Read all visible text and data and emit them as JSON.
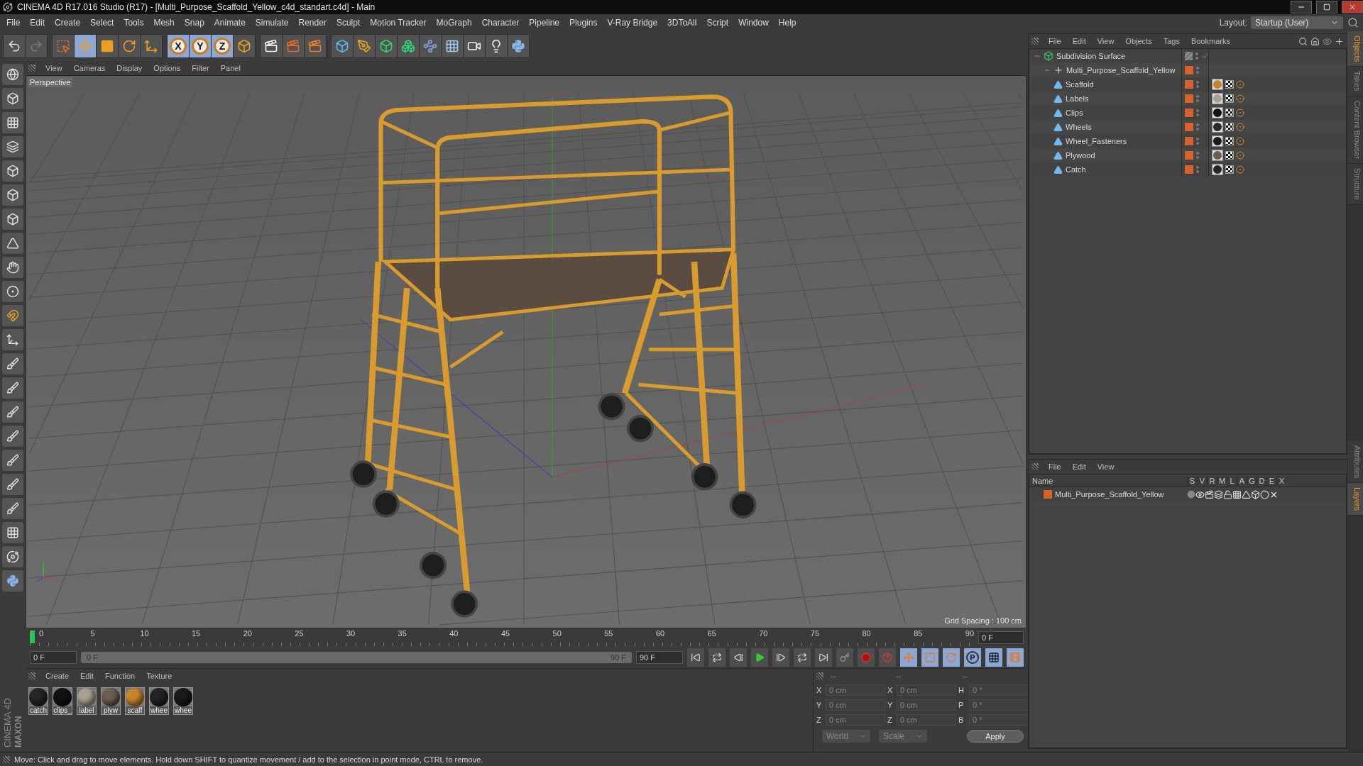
{
  "window": {
    "title": "CINEMA 4D R17.016 Studio (R17) - [Multi_Purpose_Scaffold_Yellow_c4d_standart.c4d] - Main"
  },
  "menu": [
    "File",
    "Edit",
    "Create",
    "Select",
    "Tools",
    "Mesh",
    "Snap",
    "Animate",
    "Simulate",
    "Render",
    "Sculpt",
    "Motion Tracker",
    "MoGraph",
    "Character",
    "Pipeline",
    "Plugins",
    "V-Ray Bridge",
    "3DToAll",
    "Script",
    "Window",
    "Help"
  ],
  "layout": {
    "label": "Layout:",
    "value": "Startup (User)"
  },
  "toolbar": [
    {
      "kind": "undo",
      "selected": false
    },
    {
      "kind": "redo",
      "selected": false
    },
    {
      "kind": "select",
      "selected": false
    },
    {
      "kind": "move",
      "selected": true
    },
    {
      "kind": "scale",
      "selected": false
    },
    {
      "kind": "rotate",
      "selected": false
    },
    {
      "kind": "move-add",
      "selected": false
    },
    {
      "kind": "axis",
      "glyph": "X",
      "selected": true
    },
    {
      "kind": "axis",
      "glyph": "Y",
      "selected": true
    },
    {
      "kind": "axis",
      "glyph": "Z",
      "selected": true
    },
    {
      "kind": "coords",
      "selected": false
    },
    {
      "kind": "render-view",
      "selected": false
    },
    {
      "kind": "render",
      "selected": false
    },
    {
      "kind": "render-settings",
      "selected": false
    },
    {
      "kind": "cube",
      "selected": false
    },
    {
      "kind": "pen",
      "selected": false
    },
    {
      "kind": "subdivision",
      "selected": false
    },
    {
      "kind": "cloner",
      "selected": false
    },
    {
      "kind": "deformer",
      "selected": false
    },
    {
      "kind": "floor",
      "selected": false
    },
    {
      "kind": "camera",
      "selected": false
    },
    {
      "kind": "light",
      "selected": false
    },
    {
      "kind": "python",
      "selected": false
    }
  ],
  "viewport": {
    "menu": [
      "View",
      "Cameras",
      "Display",
      "Options",
      "Filter",
      "Panel"
    ],
    "camera": "Perspective",
    "grid_spacing": "Grid Spacing : 100 cm"
  },
  "timeline": {
    "ticks": [
      "0",
      "5",
      "10",
      "15",
      "20",
      "25",
      "30",
      "35",
      "40",
      "45",
      "50",
      "55",
      "60",
      "65",
      "70",
      "75",
      "80",
      "85",
      "90"
    ],
    "current": "0 F",
    "start": "0 F",
    "range": {
      "start": "0 F",
      "end": "90 F",
      "level": 1
    },
    "end": "90 F"
  },
  "anim_tools": [
    {
      "kind": "move",
      "selected": true
    },
    {
      "kind": "scale",
      "selected": true
    },
    {
      "kind": "rotate",
      "selected": true
    },
    {
      "kind": "param",
      "glyph": "P",
      "selected": true
    },
    {
      "kind": "grid",
      "selected": true
    },
    {
      "kind": "film",
      "selected": true
    }
  ],
  "materials": {
    "menu": [
      "Create",
      "Edit",
      "Function",
      "Texture"
    ],
    "items": [
      {
        "name": "catch",
        "color": "#262626"
      },
      {
        "name": "clips_",
        "color": "#111111"
      },
      {
        "name": "label",
        "color": "#a8a090"
      },
      {
        "name": "plyw",
        "color": "#6e5e50"
      },
      {
        "name": "scaff",
        "color": "#c4862c"
      },
      {
        "name": "whee",
        "color": "#232323"
      },
      {
        "name": "whee",
        "color": "#1a1a1a"
      }
    ]
  },
  "coordinates": {
    "headers": [
      "--",
      "--",
      "--"
    ],
    "rows": [
      {
        "axis": "X",
        "position": "0 cm",
        "size_axis": "X",
        "size": "0 cm",
        "rot_axis": "H",
        "rotation": "0 °"
      },
      {
        "axis": "Y",
        "position": "0 cm",
        "size_axis": "Y",
        "size": "0 cm",
        "rot_axis": "P",
        "rotation": "0 °"
      },
      {
        "axis": "Z",
        "position": "0 cm",
        "size_axis": "Z",
        "size": "0 cm",
        "rot_axis": "B",
        "rotation": "0 °"
      }
    ],
    "space": "World",
    "mode": "Scale",
    "apply": "Apply"
  },
  "objects": {
    "menu": [
      "File",
      "Edit",
      "View",
      "Objects",
      "Tags",
      "Bookmarks"
    ],
    "tree": [
      {
        "name": "Subdivision Surface",
        "kind": "subdivision",
        "enabled": true,
        "children": [
          {
            "name": "Multi_Purpose_Scaffold_Yellow",
            "kind": "null",
            "color": "#d9622b",
            "children": [
              {
                "name": "Scaffold",
                "kind": "mesh",
                "color": "#d9622b",
                "tag": {
                  "color": "#c4862c"
                }
              },
              {
                "name": "Labels",
                "kind": "mesh",
                "color": "#d9622b",
                "tag": {
                  "color": "#a8a090"
                }
              },
              {
                "name": "Clips",
                "kind": "mesh",
                "color": "#d9622b",
                "tag": {
                  "color": "#111111"
                }
              },
              {
                "name": "Wheels",
                "kind": "mesh",
                "color": "#d9622b",
                "tag": {
                  "color": "#2a2a2a"
                }
              },
              {
                "name": "Wheel_Fasteners",
                "kind": "mesh",
                "color": "#d9622b",
                "tag": {
                  "color": "#1c1c1c"
                }
              },
              {
                "name": "Plywood",
                "kind": "mesh",
                "color": "#d9622b",
                "tag": {
                  "color": "#6e5e50"
                }
              },
              {
                "name": "Catch",
                "kind": "mesh",
                "color": "#d9622b",
                "tag": {
                  "color": "#262626"
                }
              }
            ]
          }
        ]
      }
    ]
  },
  "layers": {
    "menu": [
      "File",
      "Edit",
      "View"
    ],
    "columns": [
      "Name",
      "S",
      "V",
      "R",
      "M",
      "L",
      "A",
      "G",
      "D",
      "E",
      "X"
    ],
    "rows": [
      {
        "name": "Multi_Purpose_Scaffold_Yellow",
        "color": "#d9622b"
      }
    ]
  },
  "side_tabs_top": [
    {
      "label": "Objects",
      "selected": true
    },
    {
      "label": "Takes",
      "selected": false
    },
    {
      "label": "Content Browser",
      "selected": false
    },
    {
      "label": "Structure",
      "selected": false
    }
  ],
  "side_tabs_bottom": [
    {
      "label": "Attributes",
      "selected": false
    },
    {
      "label": "Layers",
      "selected": true
    }
  ],
  "brand": {
    "maker": "MAXON",
    "product": "CINEMA 4D"
  },
  "status_bar": "Move: Click and drag to move elements. Hold down SHIFT to quantize movement / add to the selection in point mode, CTRL to remove."
}
